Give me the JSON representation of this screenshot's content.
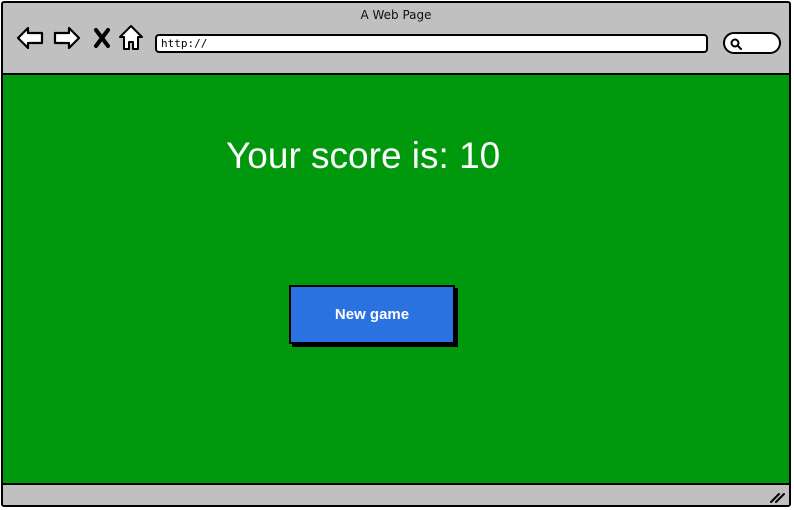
{
  "window": {
    "title": "A Web Page"
  },
  "toolbar": {
    "back_icon": "back-arrow-icon",
    "forward_icon": "forward-arrow-icon",
    "stop_icon": "close-icon",
    "home_icon": "home-icon",
    "url": "http://",
    "search_icon": "search-icon"
  },
  "page": {
    "background_color": "#00990d",
    "score_text": "Your score is: 10",
    "new_game_label": "New game",
    "button_color": "#2a72e0"
  },
  "status_bar": {
    "resize_icon": "resize-grip-icon"
  }
}
